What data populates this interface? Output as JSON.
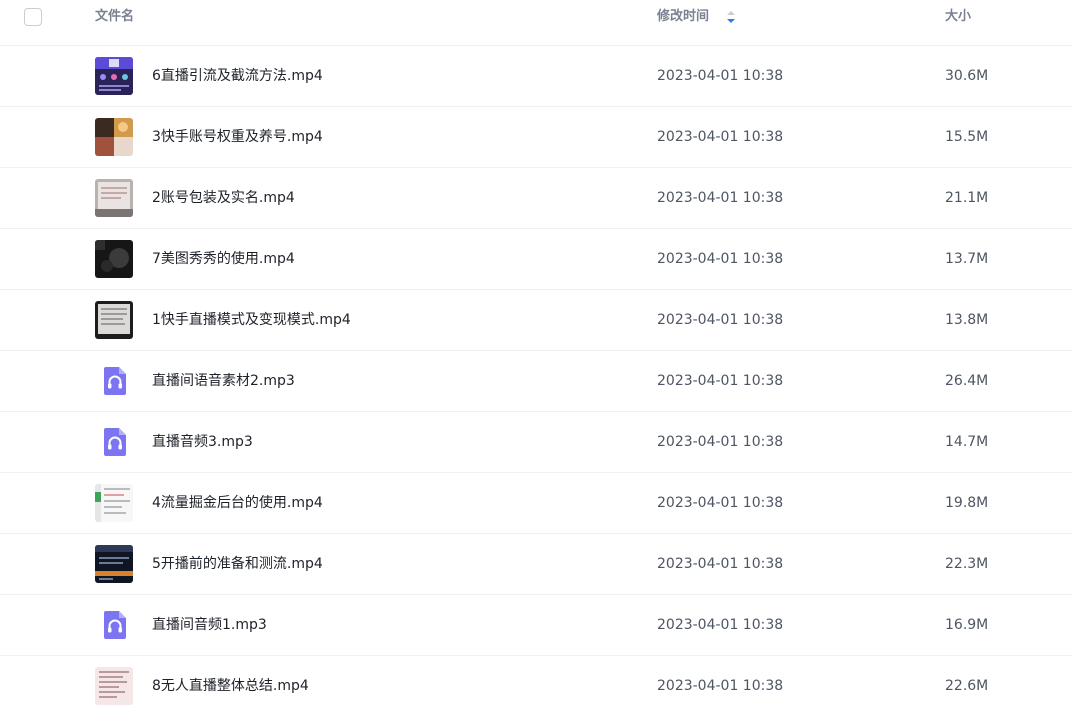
{
  "header": {
    "name_label": "文件名",
    "time_label": "修改时间",
    "size_label": "大小",
    "sort_icon": "sort-descending-icon",
    "accent_color": "#2f7bf5"
  },
  "files": [
    {
      "name": "6直播引流及截流方法.mp4",
      "time": "2023-04-01 10:38",
      "size": "30.6M",
      "type": "video",
      "thumb": "video-thumbnail"
    },
    {
      "name": "3快手账号权重及养号.mp4",
      "time": "2023-04-01 10:38",
      "size": "15.5M",
      "type": "video",
      "thumb": "video-thumbnail"
    },
    {
      "name": "2账号包装及实名.mp4",
      "time": "2023-04-01 10:38",
      "size": "21.1M",
      "type": "video",
      "thumb": "video-thumbnail"
    },
    {
      "name": "7美图秀秀的使用.mp4",
      "time": "2023-04-01 10:38",
      "size": "13.7M",
      "type": "video",
      "thumb": "video-thumbnail"
    },
    {
      "name": "1快手直播模式及变现模式.mp4",
      "time": "2023-04-01 10:38",
      "size": "13.8M",
      "type": "video",
      "thumb": "video-thumbnail"
    },
    {
      "name": "直播间语音素材2.mp3",
      "time": "2023-04-01 10:38",
      "size": "26.4M",
      "type": "audio",
      "thumb": "audio-file-icon"
    },
    {
      "name": "直播音频3.mp3",
      "time": "2023-04-01 10:38",
      "size": "14.7M",
      "type": "audio",
      "thumb": "audio-file-icon"
    },
    {
      "name": "4流量掘金后台的使用.mp4",
      "time": "2023-04-01 10:38",
      "size": "19.8M",
      "type": "video",
      "thumb": "video-thumbnail"
    },
    {
      "name": "5开播前的准备和测流.mp4",
      "time": "2023-04-01 10:38",
      "size": "22.3M",
      "type": "video",
      "thumb": "video-thumbnail"
    },
    {
      "name": "直播间音频1.mp3",
      "time": "2023-04-01 10:38",
      "size": "16.9M",
      "type": "audio",
      "thumb": "audio-file-icon"
    },
    {
      "name": "8无人直播整体总结.mp4",
      "time": "2023-04-01 10:38",
      "size": "22.6M",
      "type": "video",
      "thumb": "video-thumbnail"
    }
  ]
}
